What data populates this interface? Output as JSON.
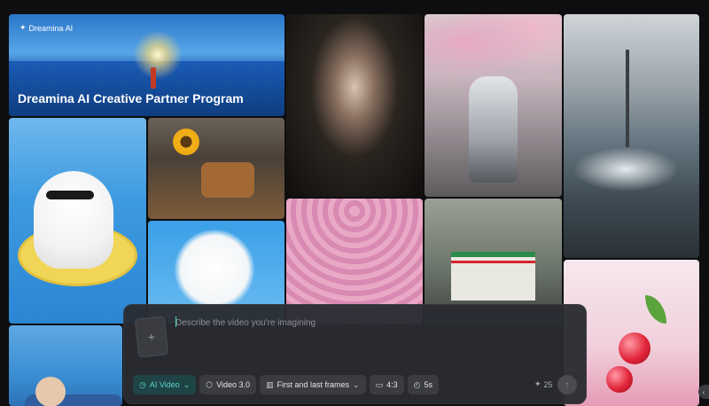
{
  "banner": {
    "logo_text": "Dreamina AI",
    "title": "Dreamina AI Creative Partner Program"
  },
  "gallery": {
    "items": [
      {
        "name": "gallery-anime-portrait"
      },
      {
        "name": "gallery-robot-praying"
      },
      {
        "name": "gallery-tsunami-city"
      },
      {
        "name": "gallery-cat-pool"
      },
      {
        "name": "gallery-steampunk-sunflower"
      },
      {
        "name": "gallery-cloud-fox"
      },
      {
        "name": "gallery-pink-figures"
      },
      {
        "name": "gallery-convenience-store"
      },
      {
        "name": "gallery-cherries"
      },
      {
        "name": "gallery-elderly-man"
      }
    ]
  },
  "prompt": {
    "placeholder": "Describe the video you're imagining",
    "value": "",
    "upload_icon": "plus-icon"
  },
  "toolbar": {
    "mode_label": "AI Video",
    "model_label": "Video 3.0",
    "frames_label": "First and last frames",
    "ratio_label": "4:3",
    "duration_label": "5s",
    "credits": "25"
  },
  "colors": {
    "accent": "#5fd4c9",
    "panel": "#2a2c32",
    "chip": "#3a3c42"
  }
}
